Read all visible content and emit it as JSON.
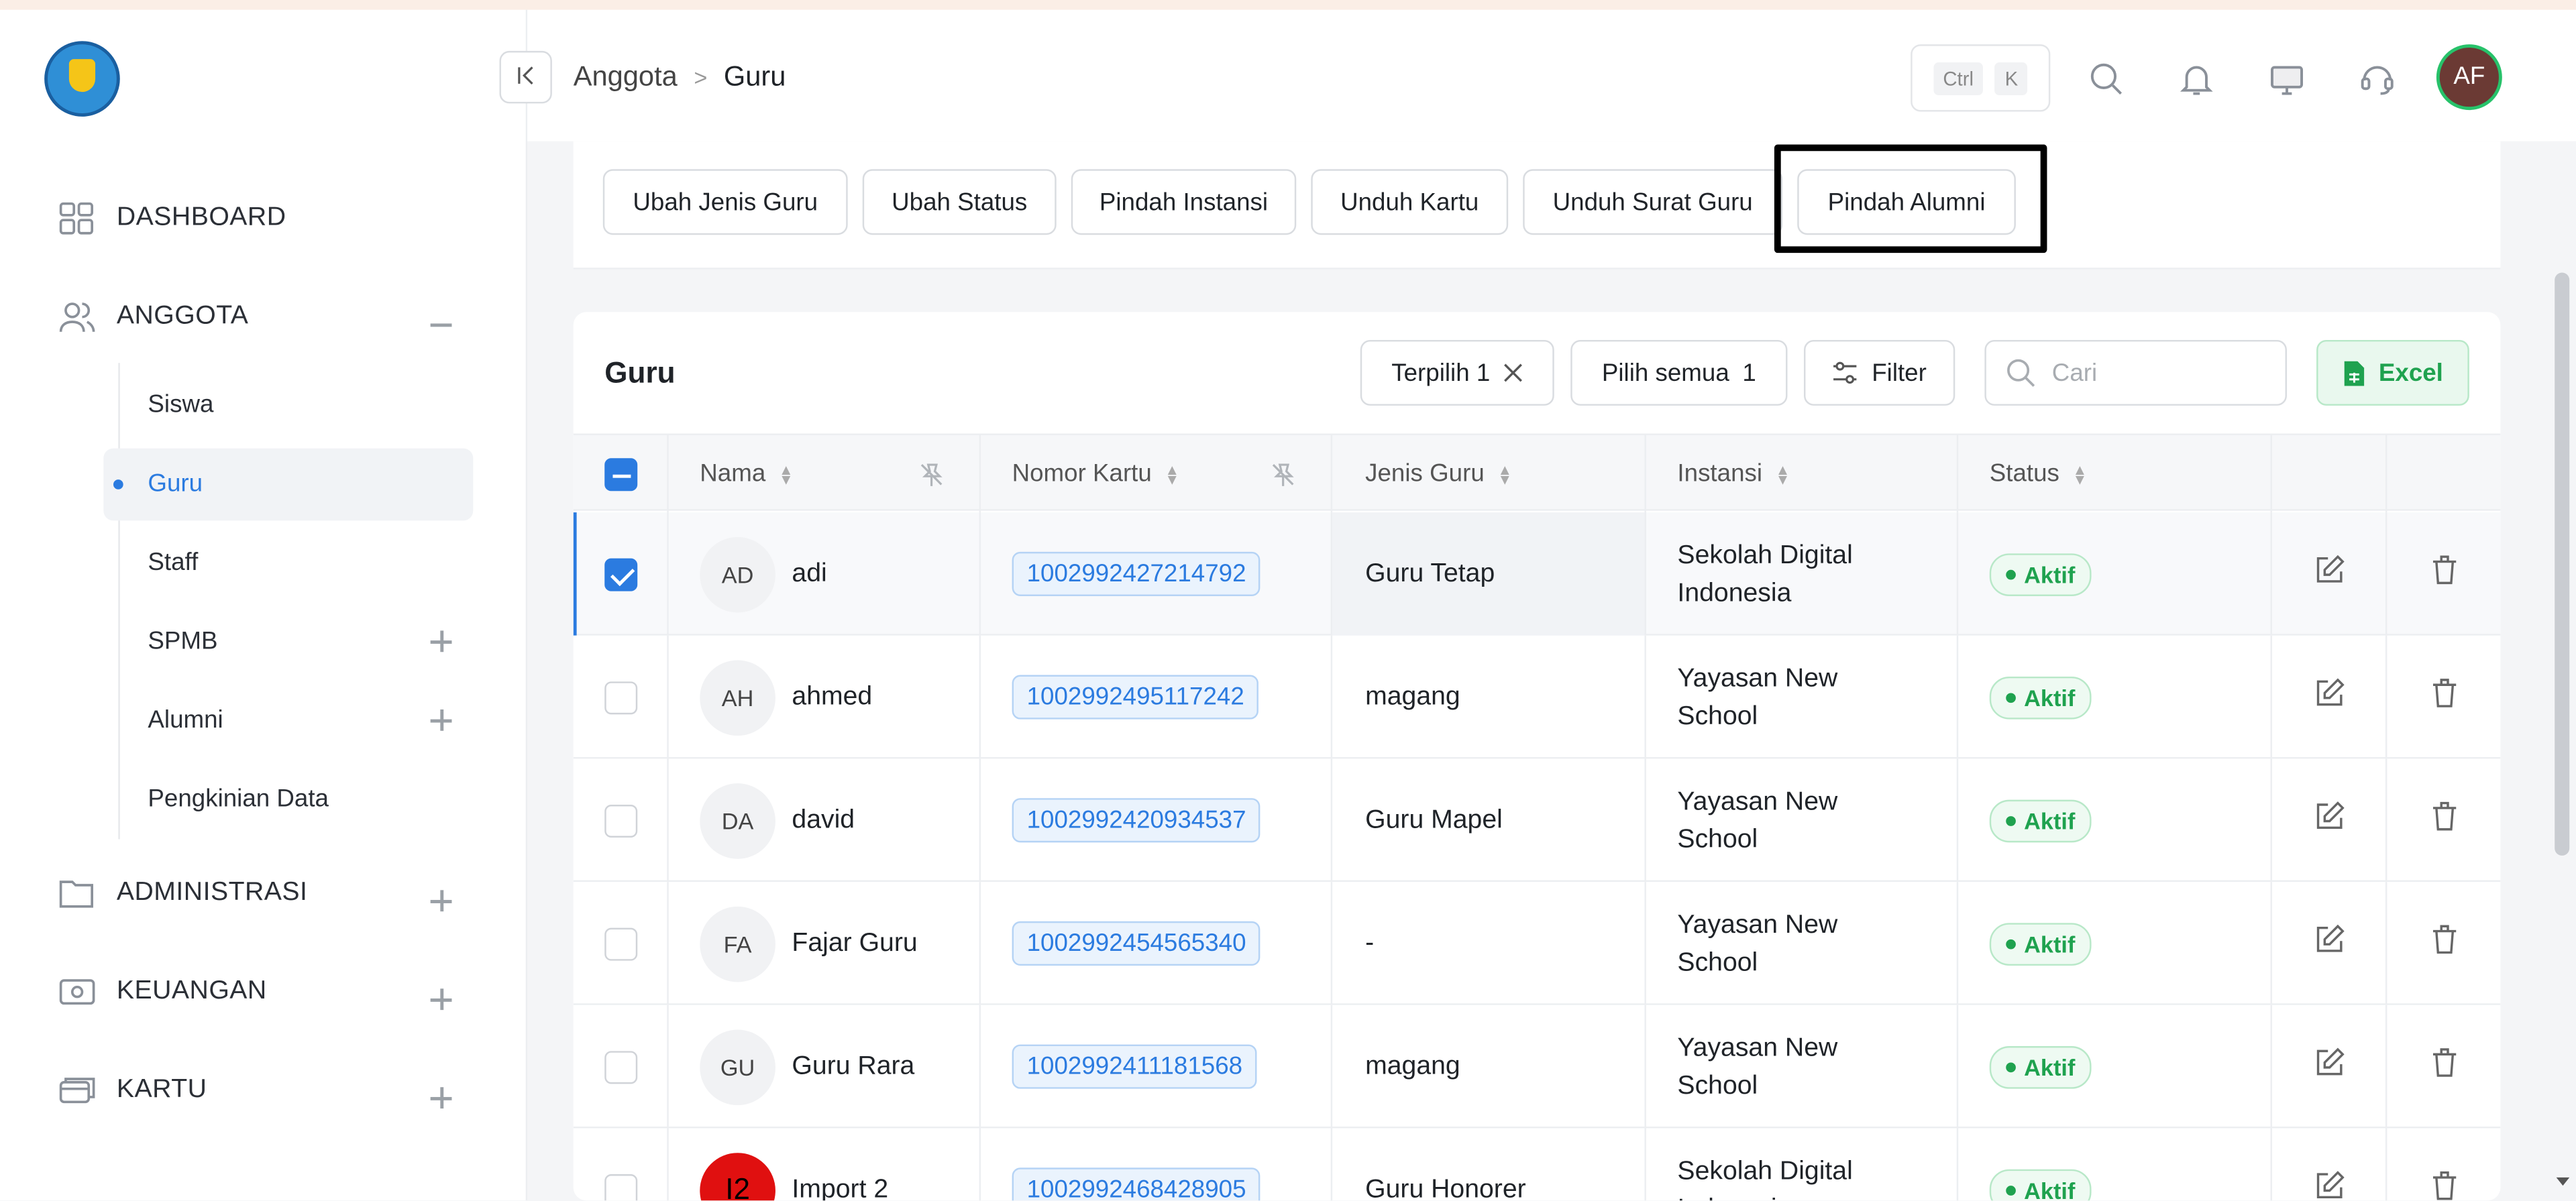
{
  "breadcrumb": {
    "parent": "Anggota",
    "current": "Guru",
    "separator": ">"
  },
  "shortcut": {
    "key1": "Ctrl",
    "key2": "K"
  },
  "user": {
    "initials": "AF"
  },
  "sidebar": {
    "items": [
      {
        "label": "DASHBOARD"
      },
      {
        "label": "ANGGOTA"
      },
      {
        "label": "ADMINISTRASI"
      },
      {
        "label": "KEUANGAN"
      },
      {
        "label": "KARTU"
      }
    ],
    "anggota_sub": [
      {
        "label": "Siswa"
      },
      {
        "label": "Guru"
      },
      {
        "label": "Staff"
      },
      {
        "label": "SPMB"
      },
      {
        "label": "Alumni"
      },
      {
        "label": "Pengkinian Data"
      }
    ]
  },
  "actions": {
    "ubah_jenis": "Ubah Jenis Guru",
    "ubah_status": "Ubah Status",
    "pindah_instansi": "Pindah Instansi",
    "unduh_kartu": "Unduh Kartu",
    "unduh_surat": "Unduh Surat Guru",
    "pindah_alumni": "Pindah Alumni"
  },
  "table_toolbar": {
    "title": "Guru",
    "terpilih": "Terpilih 1",
    "pilih_semua": "Pilih semua",
    "pilih_semua_count": "1",
    "filter": "Filter",
    "search_placeholder": "Cari",
    "excel": "Excel"
  },
  "columns": {
    "nama": "Nama",
    "nomor_kartu": "Nomor Kartu",
    "jenis_guru": "Jenis Guru",
    "instansi": "Instansi",
    "status": "Status"
  },
  "rows": [
    {
      "initials": "AD",
      "name": "adi",
      "card": "1002992427214792",
      "jenis": "Guru Tetap",
      "inst1": "Sekolah Digital",
      "inst2": "Indonesia",
      "status": "Aktif"
    },
    {
      "initials": "AH",
      "name": "ahmed",
      "card": "1002992495117242",
      "jenis": "magang",
      "inst1": "Yayasan New",
      "inst2": "School",
      "status": "Aktif"
    },
    {
      "initials": "DA",
      "name": "david",
      "card": "1002992420934537",
      "jenis": "Guru Mapel",
      "inst1": "Yayasan New",
      "inst2": "School",
      "status": "Aktif"
    },
    {
      "initials": "FA",
      "name": "Fajar Guru",
      "card": "1002992454565340",
      "jenis": "-",
      "inst1": "Yayasan New",
      "inst2": "School",
      "status": "Aktif"
    },
    {
      "initials": "GU",
      "name": "Guru Rara",
      "card": "1002992411181568",
      "jenis": "magang",
      "inst1": "Yayasan New",
      "inst2": "School",
      "status": "Aktif"
    },
    {
      "initials": "I2",
      "name": "Import 2",
      "card": "1002992468428905",
      "jenis": "Guru Honorer",
      "inst1": "Sekolah Digital",
      "inst2": "Indonesia",
      "status": "Aktif"
    }
  ]
}
